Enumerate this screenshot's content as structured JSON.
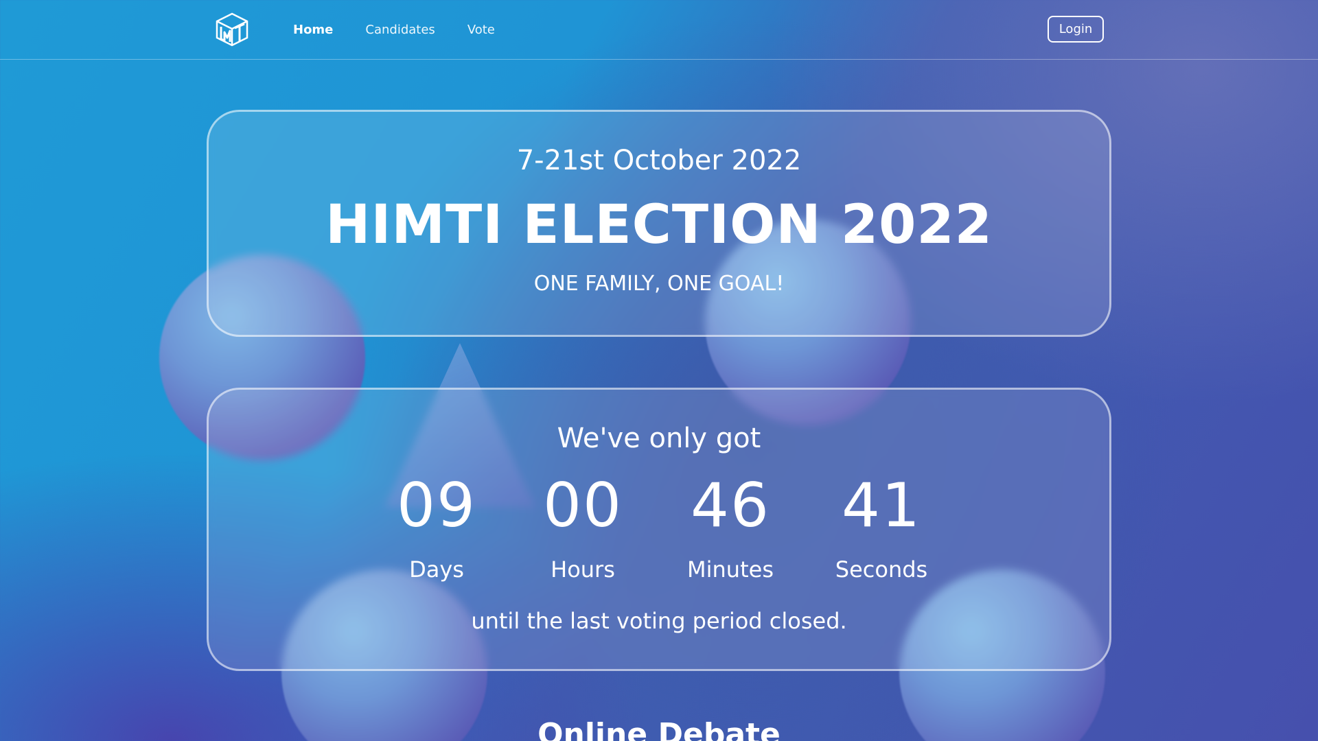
{
  "navbar": {
    "logo_icon": "himti-cube-logo-icon",
    "links": [
      {
        "label": "Home",
        "active": true
      },
      {
        "label": "Candidates",
        "active": false
      },
      {
        "label": "Vote",
        "active": false
      }
    ],
    "login_label": "Login"
  },
  "hero": {
    "date": "7-21st October 2022",
    "title": "HIMTI ELECTION 2022",
    "tagline": "ONE FAMILY, ONE GOAL!"
  },
  "countdown": {
    "heading": "We've only got",
    "units": [
      {
        "value": "09",
        "label": "Days"
      },
      {
        "value": "00",
        "label": "Hours"
      },
      {
        "value": "46",
        "label": "Minutes"
      },
      {
        "value": "41",
        "label": "Seconds"
      }
    ],
    "footer": "until the last voting period closed."
  },
  "next_section": {
    "heading": "Online Debate"
  },
  "colors": {
    "background_start": "#1f9ad6",
    "background_end": "#4650ad",
    "text": "#ffffff"
  }
}
